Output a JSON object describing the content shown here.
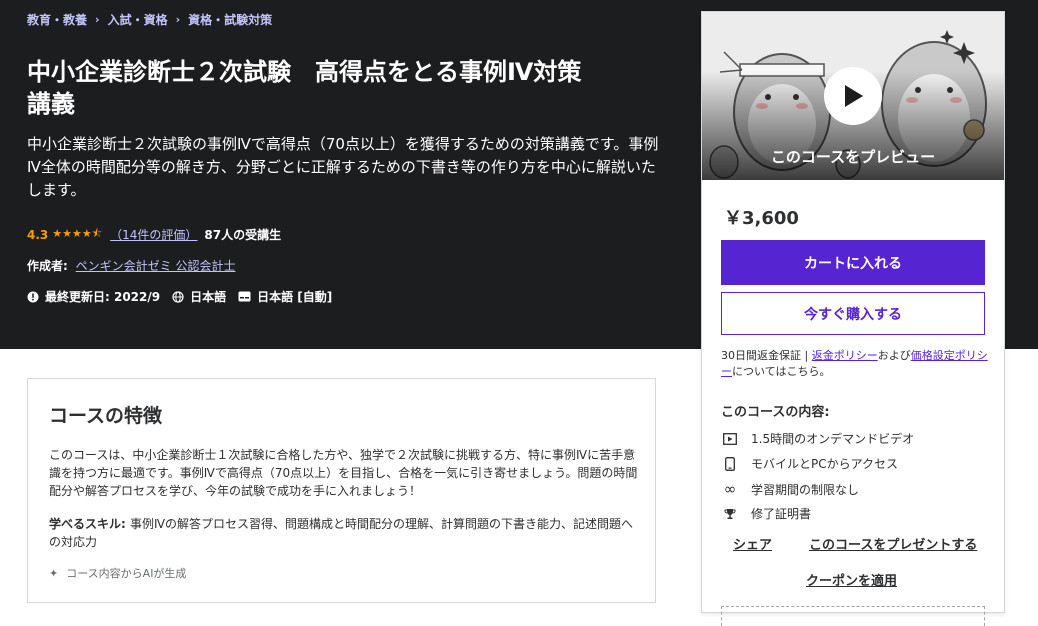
{
  "breadcrumb": [
    "教育・教養",
    "入試・資格",
    "資格・試験対策"
  ],
  "course": {
    "title_line1": "中小企業診断士２次試験　高得点をとる事例Ⅳ対策",
    "title_line2": "講義",
    "subtitle": "中小企業診断士２次試験の事例Ⅳで高得点（70点以上）を獲得するための対策講義です。事例Ⅳ全体の時間配分等の解き方、分野ごとに正解するための下書き等の作り方を中心に解説いたします。",
    "rating": "4.3",
    "rating_value": 4.3,
    "rating_count": "（14件の評価）",
    "students": "87人の受講生",
    "author_label": "作成者:",
    "author": "ペンギン会計ゼミ 公認会計士",
    "updated": "最終更新日: 2022/9",
    "language": "日本語",
    "captions": "日本語 [自動]"
  },
  "sidebar": {
    "preview_label": "このコースをプレビュー",
    "price": "￥3,600",
    "cart_button": "カートに入れる",
    "buy_button": "今すぐ購入する",
    "guarantee_text": "30日間返金保証 | ",
    "refund_policy": "返金ポリシー",
    "and_text": "および",
    "price_policy": "価格設定ポリシー",
    "tail_text": "についてはこちら。",
    "includes_heading": "このコースの内容:",
    "includes": [
      {
        "icon": "video-icon",
        "label": "1.5時間のオンデマンドビデオ"
      },
      {
        "icon": "mobile-icon",
        "label": "モバイルとPCからアクセス"
      },
      {
        "icon": "infinity-icon",
        "label": "学習期間の制限なし"
      },
      {
        "icon": "trophy-icon",
        "label": "修了証明書"
      }
    ],
    "share": "シェア",
    "gift": "このコースをプレゼントする",
    "coupon": "クーポンを適用"
  },
  "features": {
    "heading": "コースの特徴",
    "body": "このコースは、中小企業診断士１次試験に合格した方や、独学で２次試験に挑戦する方、特に事例Ⅳに苦手意識を持つ方に最適です。事例Ⅳで高得点（70点以上）を目指し、合格を一気に引き寄せましょう。問題の時間配分や解答プロセスを学び、今年の試験で成功を手に入れましょう！",
    "skills_label": "学べるスキル: ",
    "skills": "事例Ⅳの解答プロセス習得、問題構成と時間配分の理解、計算問題の下書き能力、記述問題への対応力",
    "ai_note": "コース内容からAIが生成"
  },
  "colors": {
    "hero_bg": "#1c1d1f",
    "accent": "#5624d0",
    "link": "#c0c4fc",
    "star": "#f69c08"
  }
}
